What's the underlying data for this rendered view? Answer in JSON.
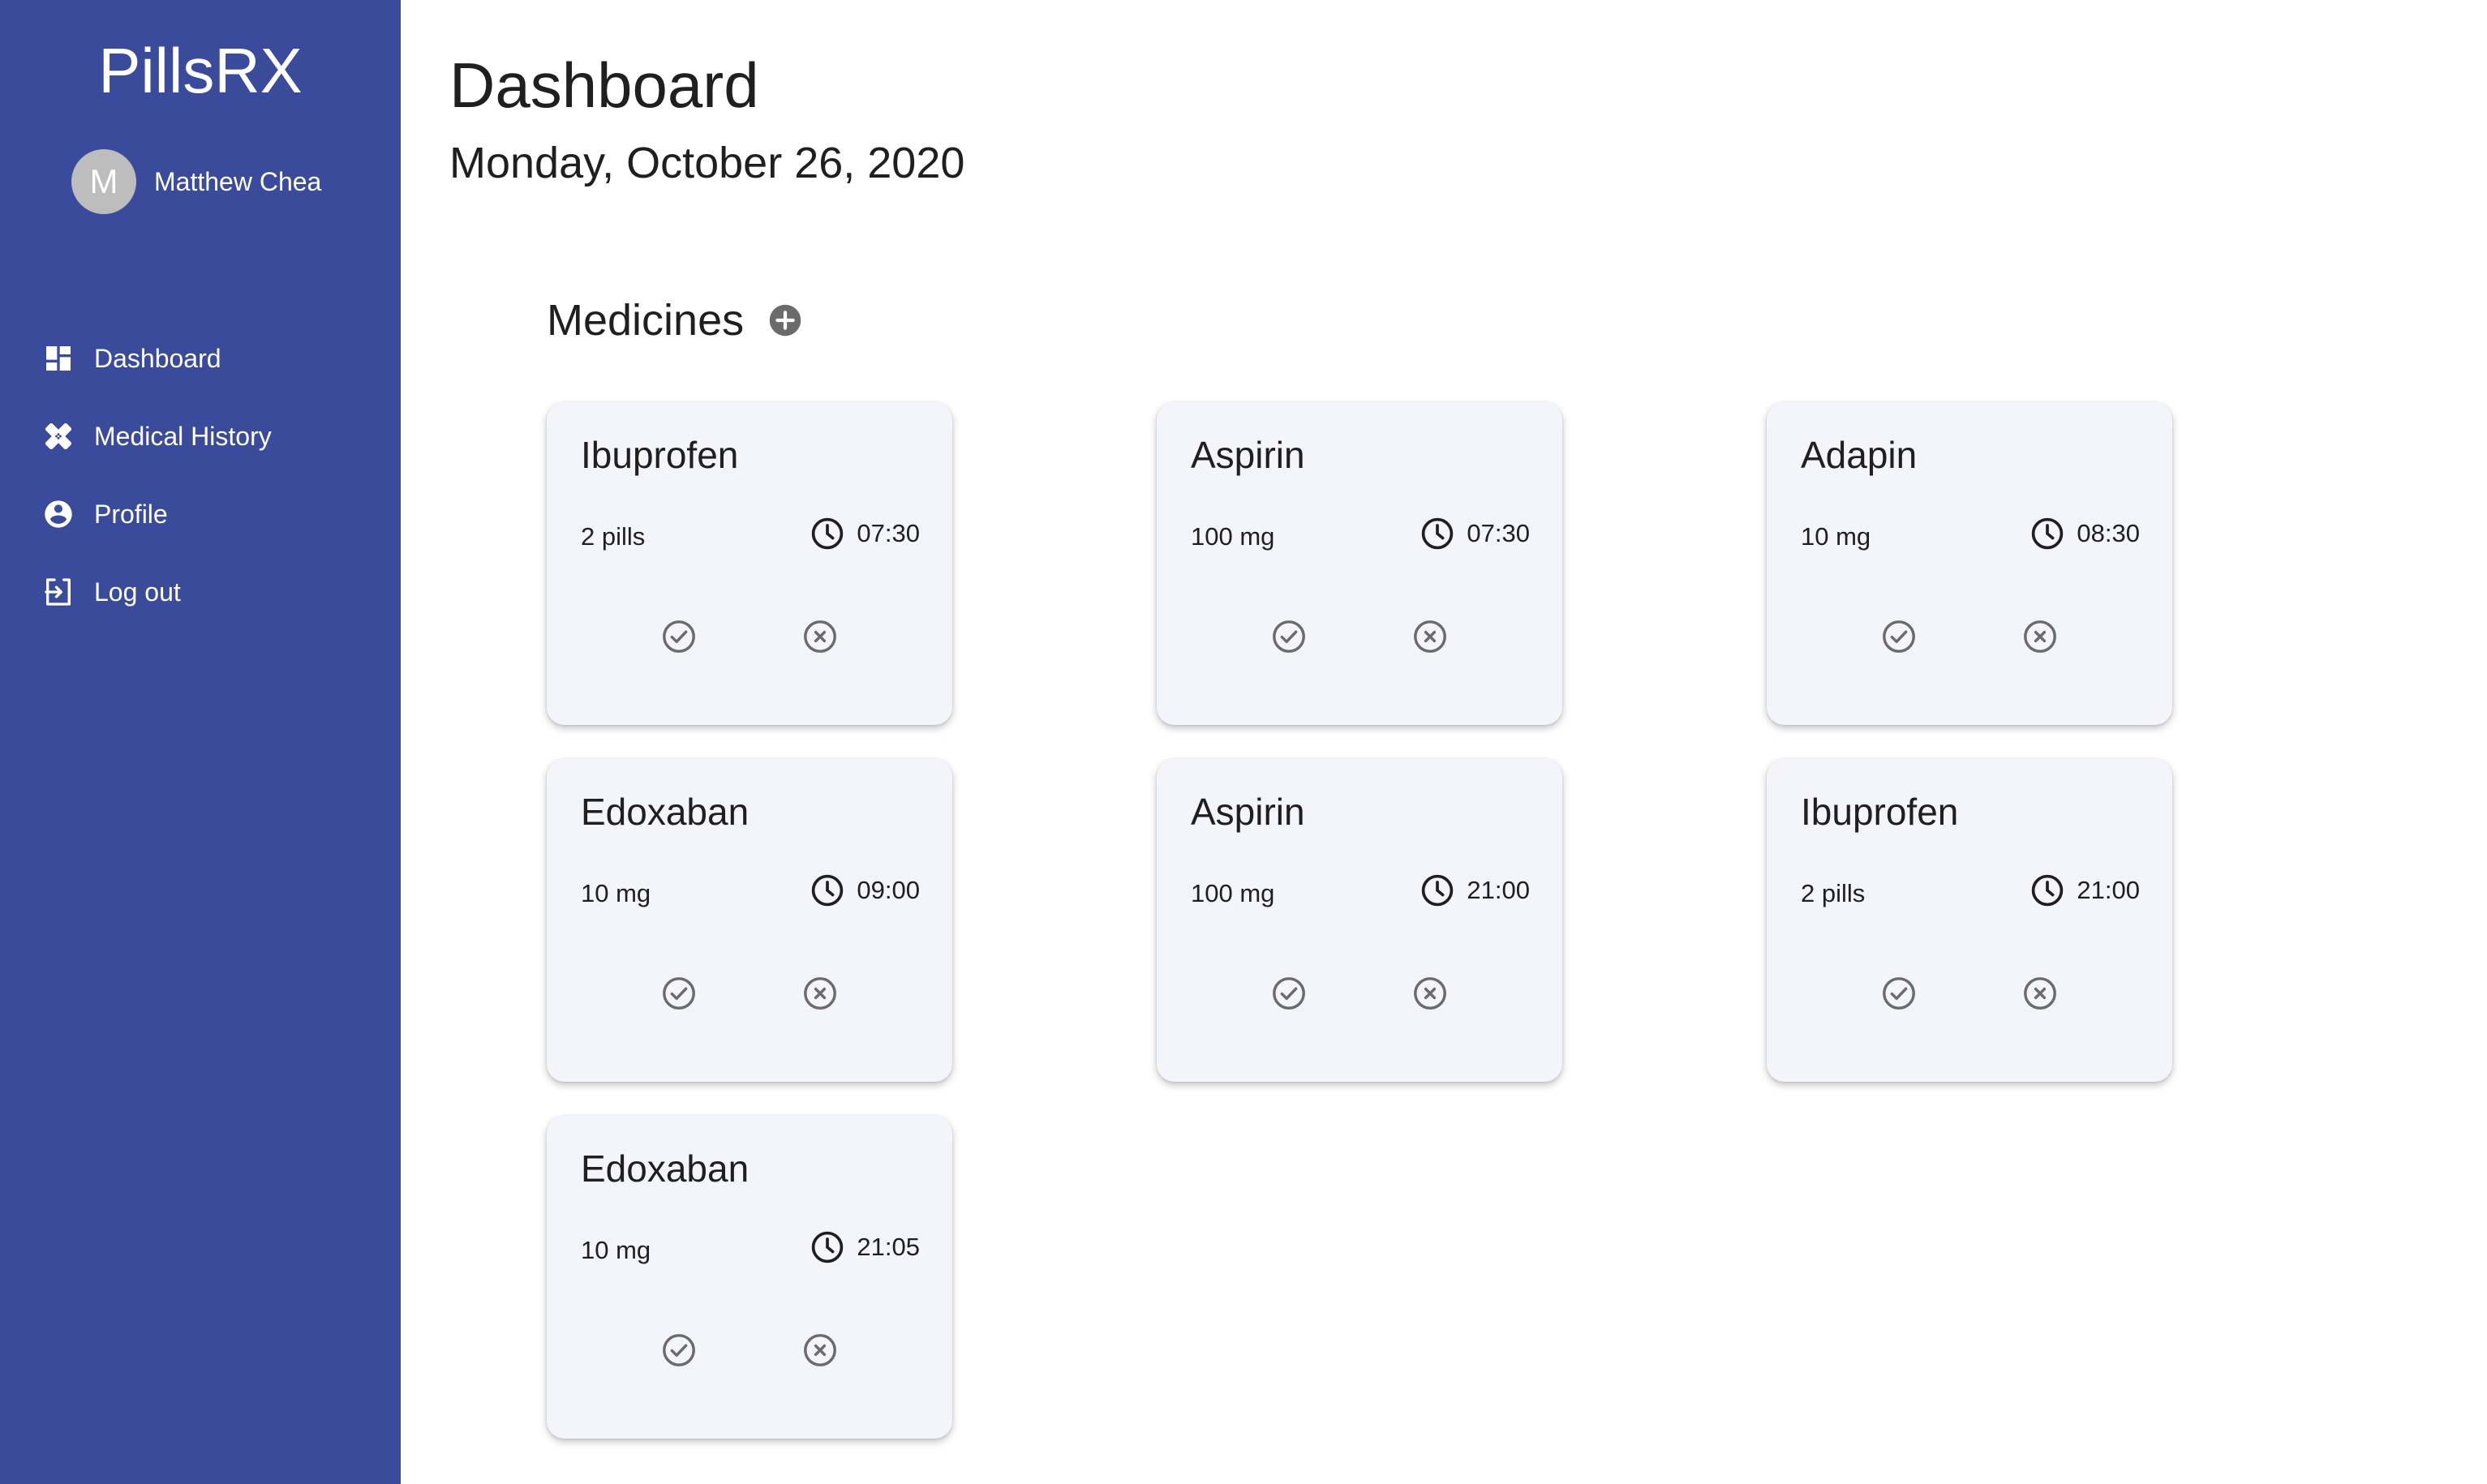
{
  "app": {
    "title": "PillsRX"
  },
  "user": {
    "initial": "M",
    "name": "Matthew Chea"
  },
  "sidebar": {
    "items": [
      {
        "label": "Dashboard",
        "icon": "dashboard-icon"
      },
      {
        "label": "Medical History",
        "icon": "bandage-icon"
      },
      {
        "label": "Profile",
        "icon": "account-circle-icon"
      },
      {
        "label": "Log out",
        "icon": "logout-icon"
      }
    ]
  },
  "header": {
    "title": "Dashboard",
    "date": "Monday, October 26, 2020"
  },
  "medicines": {
    "section_title": "Medicines",
    "items": [
      {
        "name": "Ibuprofen",
        "dose": "2 pills",
        "time": "07:30"
      },
      {
        "name": "Aspirin",
        "dose": "100 mg",
        "time": "07:30"
      },
      {
        "name": "Adapin",
        "dose": "10 mg",
        "time": "08:30"
      },
      {
        "name": "Edoxaban",
        "dose": "10 mg",
        "time": "09:00"
      },
      {
        "name": "Aspirin",
        "dose": "100 mg",
        "time": "21:00"
      },
      {
        "name": "Ibuprofen",
        "dose": "2 pills",
        "time": "21:00"
      },
      {
        "name": "Edoxaban",
        "dose": "10 mg",
        "time": "21:05"
      }
    ]
  },
  "colors": {
    "sidebar": "#3b4b9b",
    "card": "#f3f5fb",
    "icon": "#6b6b6b"
  }
}
